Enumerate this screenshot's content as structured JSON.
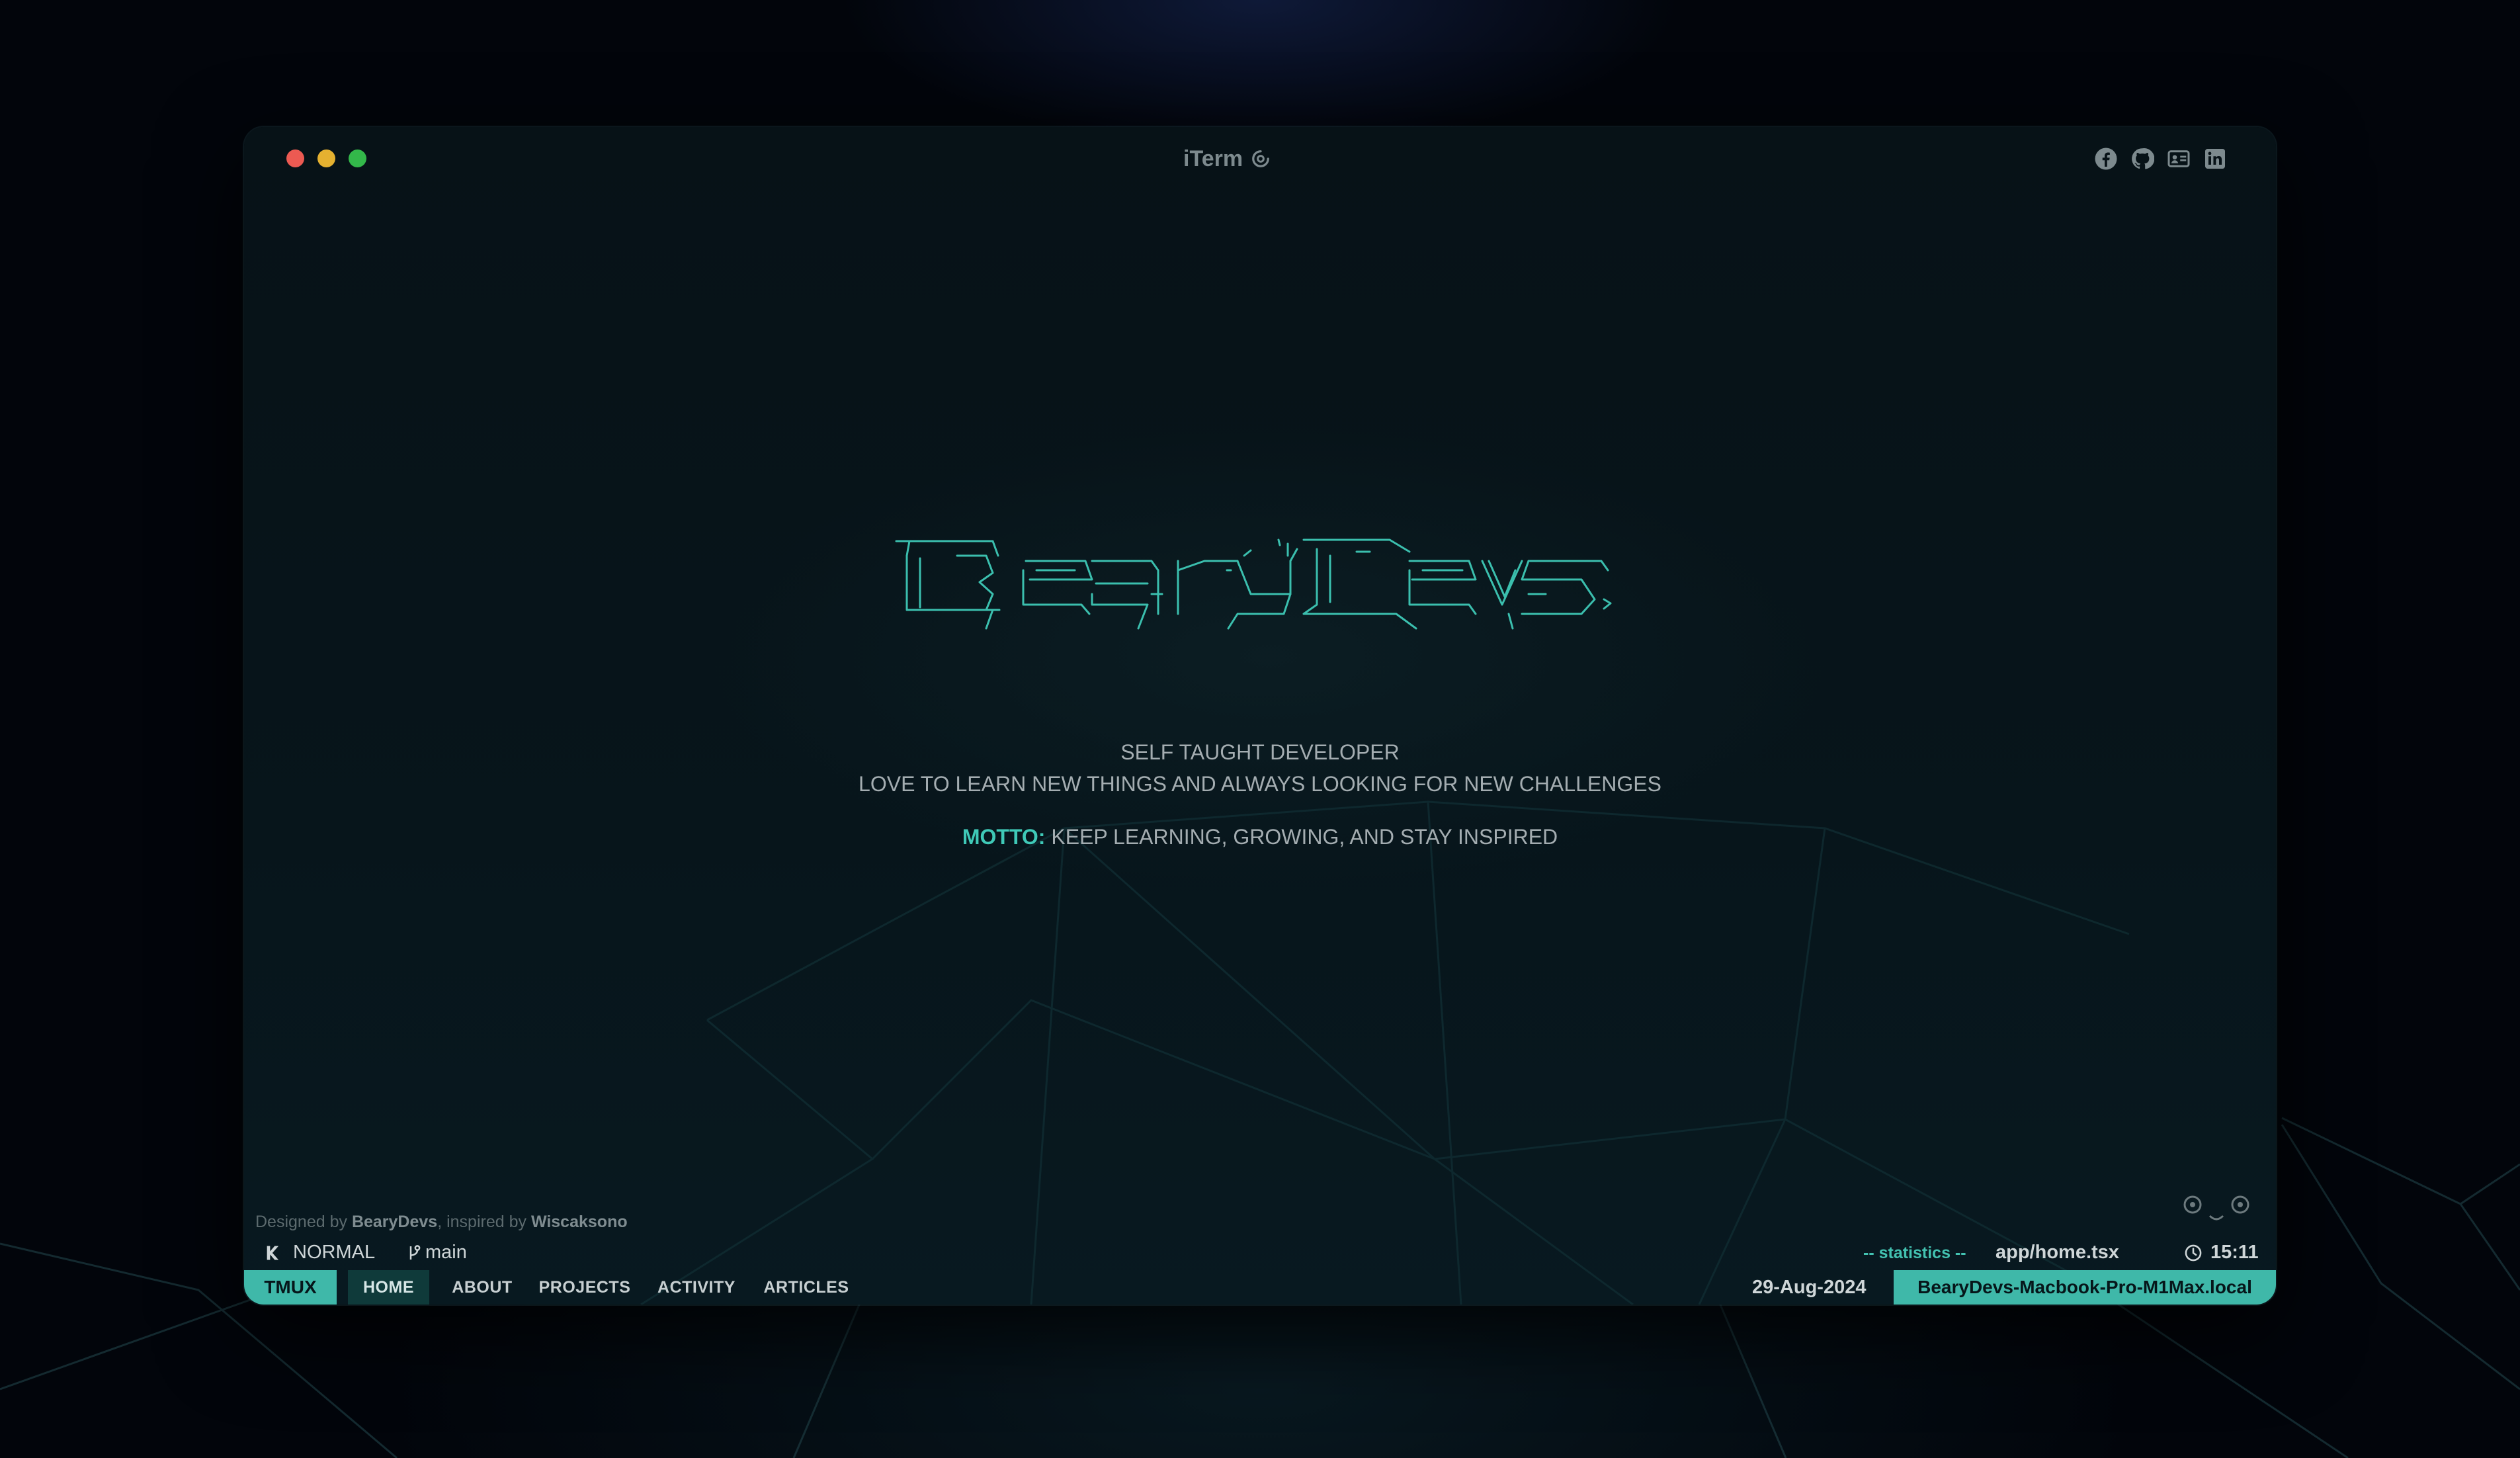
{
  "window": {
    "title": "iTerm",
    "title_icon": "github-sync-icon",
    "traffic_lights": [
      "close",
      "minimize",
      "maximize"
    ],
    "social_icons": [
      "facebook-icon",
      "github-icon",
      "contact-card-icon",
      "linkedin-icon"
    ]
  },
  "hero": {
    "logo_text": "BearyDevs",
    "line1": "SELF TAUGHT DEVELOPER",
    "line2": "LOVE TO LEARN NEW THINGS AND ALWAYS LOOKING FOR NEW CHALLENGES",
    "motto_label": "MOTTO:",
    "motto_text": "KEEP LEARNING, GROWING, AND STAY INSPIRED"
  },
  "credit": {
    "prefix": "Designed by",
    "author": "BearyDevs",
    "middle": ", inspired by",
    "inspiration": "Wiscaksono"
  },
  "statusline": {
    "mode": "NORMAL",
    "branch": "main",
    "stats": "-- statistics --",
    "file": "app/home.tsx",
    "time": "15:11"
  },
  "tmux": {
    "label": "TMUX",
    "nav": [
      "HOME",
      "ABOUT",
      "PROJECTS",
      "ACTIVITY",
      "ARTICLES"
    ],
    "active": "HOME",
    "date": "29-Aug-2024",
    "host": "BearyDevs-Macbook-Pro-M1Max.local"
  },
  "colors": {
    "accent": "#3fb8a9",
    "accent_text": "#3fc9b7",
    "close": "#ec5a52",
    "minimize": "#e5b130",
    "maximize": "#33b84a",
    "window_bg": "#071217"
  }
}
